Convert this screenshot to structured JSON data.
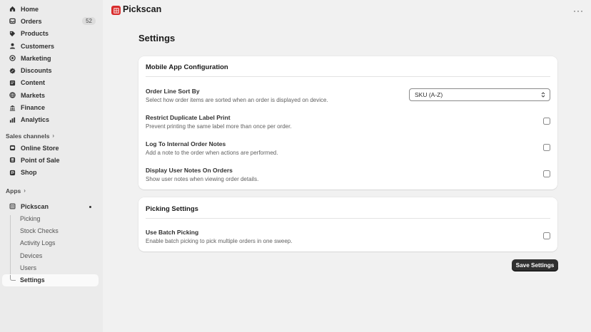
{
  "sidebar": {
    "nav": [
      {
        "label": "Home",
        "icon": "home-icon"
      },
      {
        "label": "Orders",
        "icon": "orders-icon",
        "badge": "52"
      },
      {
        "label": "Products",
        "icon": "tag-icon"
      },
      {
        "label": "Customers",
        "icon": "person-icon"
      },
      {
        "label": "Marketing",
        "icon": "target-icon"
      },
      {
        "label": "Discounts",
        "icon": "discount-icon"
      },
      {
        "label": "Content",
        "icon": "content-icon"
      },
      {
        "label": "Markets",
        "icon": "globe-icon"
      },
      {
        "label": "Finance",
        "icon": "bank-icon"
      },
      {
        "label": "Analytics",
        "icon": "chart-icon"
      }
    ],
    "sales_channels_label": "Sales channels",
    "channels": [
      {
        "label": "Online Store",
        "icon": "store-icon"
      },
      {
        "label": "Point of Sale",
        "icon": "pos-icon"
      },
      {
        "label": "Shop",
        "icon": "shop-icon"
      }
    ],
    "apps_label": "Apps",
    "app": {
      "label": "Pickscan",
      "icon": "pickscan-icon"
    },
    "app_sub": [
      "Picking",
      "Stock Checks",
      "Activity Logs",
      "Devices",
      "Users",
      "Settings"
    ]
  },
  "header": {
    "app_name": "Pickscan",
    "more": "···"
  },
  "page": {
    "title": "Settings"
  },
  "mobile_card": {
    "title": "Mobile App Configuration",
    "sort": {
      "title": "Order Line Sort By",
      "desc": "Select how order items are sorted when an order is displayed on device.",
      "value": "SKU (A-Z)"
    },
    "rows": [
      {
        "title": "Restrict Duplicate Label Print",
        "desc": "Prevent printing the same label more than once per order."
      },
      {
        "title": "Log To Internal Order Notes",
        "desc": "Add a note to the order when actions are performed."
      },
      {
        "title": "Display User Notes On Orders",
        "desc": "Show user notes when viewing order details."
      }
    ]
  },
  "picking_card": {
    "title": "Picking Settings",
    "rows": [
      {
        "title": "Use Batch Picking",
        "desc": "Enable batch picking to pick multiple orders in one sweep."
      }
    ]
  },
  "save_label": "Save Settings",
  "colors": {
    "accent": "#d82c2c",
    "primary_button": "#303030",
    "sidebar_bg": "#ebebeb",
    "page_bg": "#f1f1f1"
  }
}
